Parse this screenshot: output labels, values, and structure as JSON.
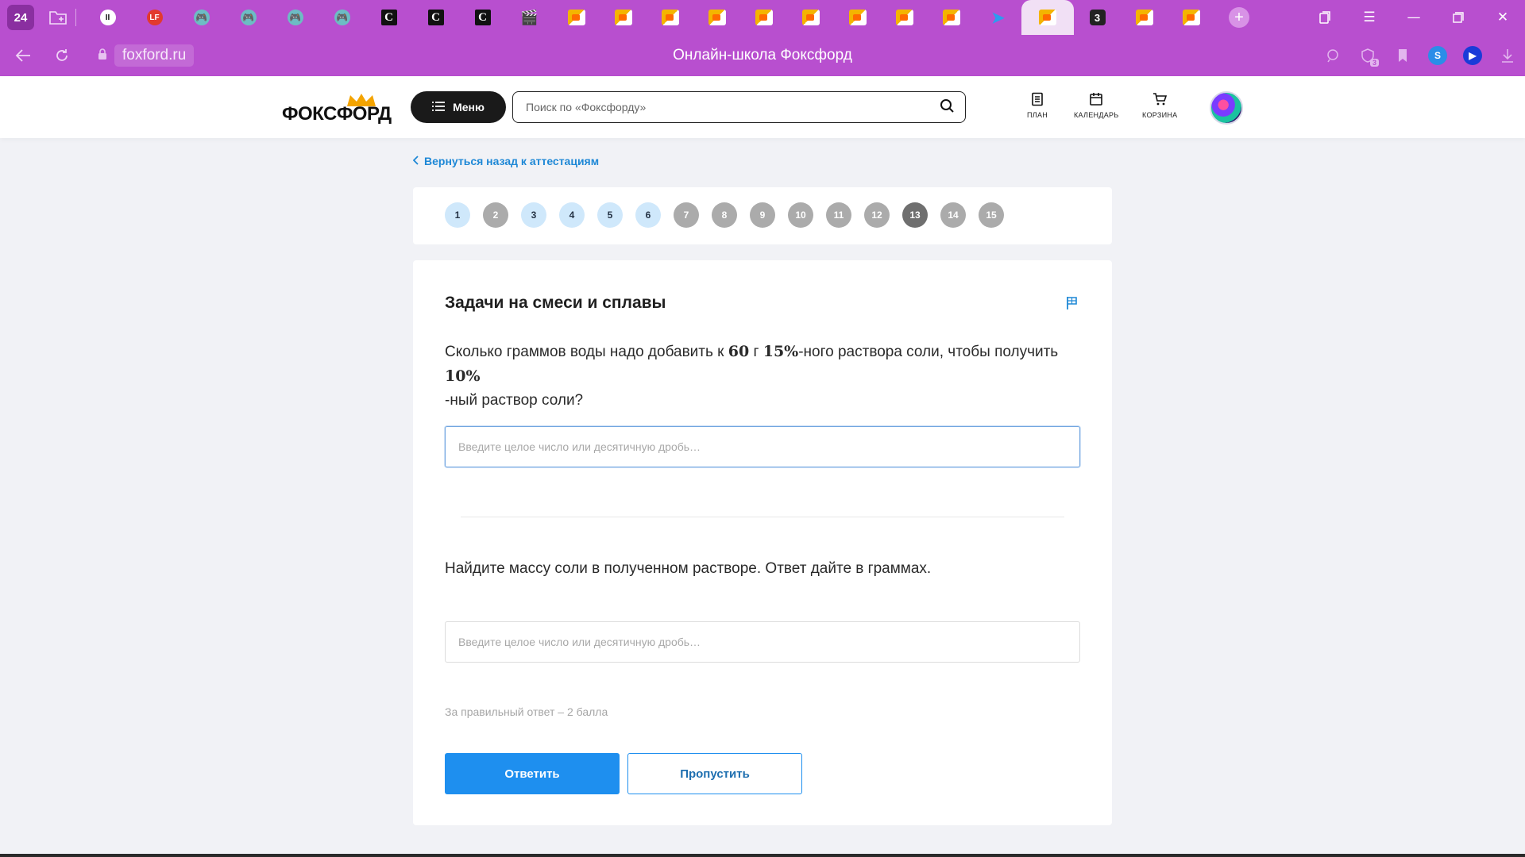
{
  "browser": {
    "tab_count": "24",
    "tabs": [
      {
        "icon": "pause-favicon",
        "glyph": "II",
        "kind": "pause"
      },
      {
        "icon": "lf-favicon",
        "glyph": "LF",
        "kind": "lf"
      },
      {
        "icon": "gamepad-favicon",
        "glyph": "🎮",
        "kind": "game"
      },
      {
        "icon": "gamepad-favicon",
        "glyph": "🎮",
        "kind": "game"
      },
      {
        "icon": "gamepad-favicon",
        "glyph": "🎮",
        "kind": "game"
      },
      {
        "icon": "gamepad-favicon",
        "glyph": "🎮",
        "kind": "game"
      },
      {
        "icon": "c-favicon",
        "glyph": "C",
        "kind": "c"
      },
      {
        "icon": "c-favicon",
        "glyph": "C",
        "kind": "c"
      },
      {
        "icon": "c-favicon",
        "glyph": "C",
        "kind": "c"
      },
      {
        "icon": "clapperboard-favicon",
        "glyph": "🎬",
        "kind": "clap"
      },
      {
        "icon": "foxford-favicon",
        "glyph": "",
        "kind": "fox"
      },
      {
        "icon": "foxford-favicon",
        "glyph": "",
        "kind": "fox"
      },
      {
        "icon": "foxford-favicon",
        "glyph": "",
        "kind": "fox"
      },
      {
        "icon": "foxford-favicon",
        "glyph": "",
        "kind": "fox"
      },
      {
        "icon": "foxford-favicon",
        "glyph": "",
        "kind": "fox"
      },
      {
        "icon": "foxford-favicon",
        "glyph": "",
        "kind": "fox"
      },
      {
        "icon": "foxford-favicon",
        "glyph": "",
        "kind": "fox"
      },
      {
        "icon": "foxford-favicon",
        "glyph": "",
        "kind": "fox"
      },
      {
        "icon": "foxford-favicon",
        "glyph": "",
        "kind": "fox"
      },
      {
        "icon": "bird-favicon",
        "glyph": "➤",
        "kind": "bird"
      },
      {
        "icon": "foxford-favicon",
        "glyph": "",
        "kind": "fox",
        "active": true
      },
      {
        "icon": "three-favicon",
        "glyph": "3",
        "kind": "three"
      },
      {
        "icon": "foxford-favicon",
        "glyph": "",
        "kind": "fox"
      },
      {
        "icon": "foxford-favicon",
        "glyph": "",
        "kind": "fox"
      }
    ],
    "url_host": "foxford.ru",
    "page_title": "Онлайн-школа Фоксфорд",
    "extension_badge": "3",
    "colors": {
      "chrome": "#b84fcf",
      "accent_light": "#e3b6ee"
    }
  },
  "header": {
    "logo_text": "ФОКСФОРД",
    "menu_label": "Меню",
    "search_placeholder": "Поиск по «Фоксфорду»",
    "links": {
      "plan": "ПЛАН",
      "calendar": "КАЛЕНДАРЬ",
      "cart": "КОРЗИНА"
    }
  },
  "back_link": "Вернуться назад к аттестациям",
  "question_nav": [
    {
      "n": "1",
      "state": "done"
    },
    {
      "n": "2",
      "state": "todo"
    },
    {
      "n": "3",
      "state": "done"
    },
    {
      "n": "4",
      "state": "done"
    },
    {
      "n": "5",
      "state": "done"
    },
    {
      "n": "6",
      "state": "done"
    },
    {
      "n": "7",
      "state": "todo"
    },
    {
      "n": "8",
      "state": "todo"
    },
    {
      "n": "9",
      "state": "todo"
    },
    {
      "n": "10",
      "state": "todo"
    },
    {
      "n": "11",
      "state": "todo"
    },
    {
      "n": "12",
      "state": "todo"
    },
    {
      "n": "13",
      "state": "current"
    },
    {
      "n": "14",
      "state": "todo"
    },
    {
      "n": "15",
      "state": "todo"
    }
  ],
  "task": {
    "title": "Задачи на смеси и сплавы",
    "q1": {
      "part1": "Сколько граммов воды надо добавить к ",
      "mass": "60",
      "part2": " г ",
      "pct1": "15%",
      "part3": "-ного раствора соли, чтобы получить ",
      "pct2": "10%",
      "part4": "-ный раствор соли?"
    },
    "answer_placeholder": "Введите целое число или десятичную дробь…",
    "q2": "Найдите массу соли в полученном растворе. Ответ дайте в граммах.",
    "score_note": "За правильный ответ – 2 балла",
    "submit_label": "Ответить",
    "skip_label": "Пропустить"
  },
  "colors": {
    "primary": "#1e8fef",
    "link": "#1e88d6",
    "done": "#cfe8fb",
    "todo": "#ababab",
    "current": "#6f6f6f"
  }
}
